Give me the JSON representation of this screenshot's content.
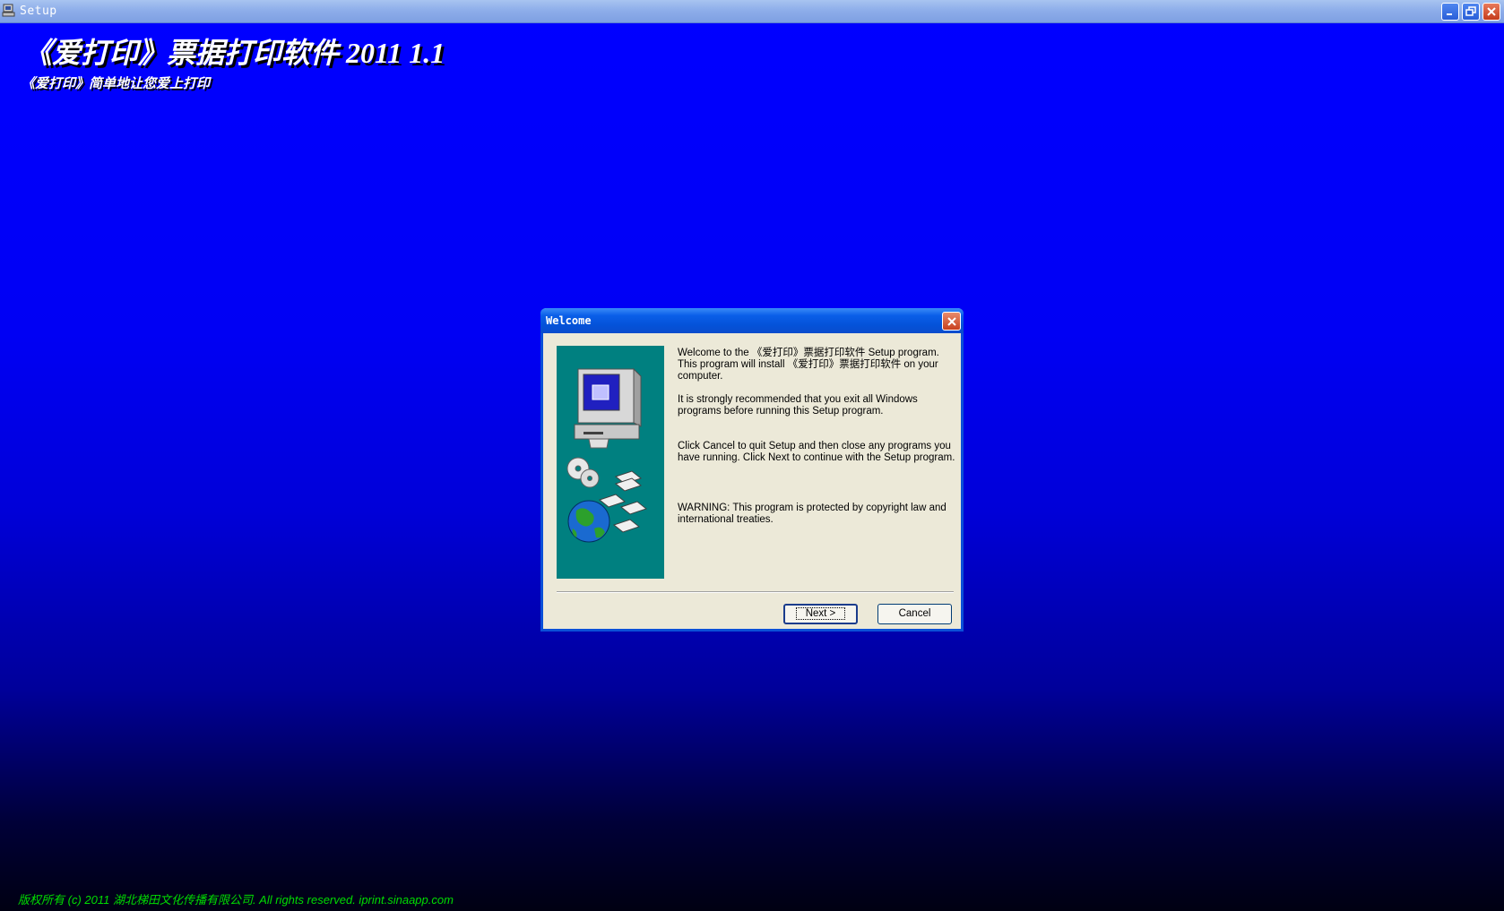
{
  "window": {
    "title": "Setup",
    "controls": [
      "minimize-icon",
      "restore-icon",
      "close-icon"
    ]
  },
  "banner": {
    "title": "《爱打印》票据打印软件 2011 1.1",
    "subtitle": "《爱打印》简单地让您爱上打印"
  },
  "dialog": {
    "title": "Welcome",
    "paragraphs": [
      "Welcome to the 《爱打印》票据打印软件 Setup program. This program will install 《爱打印》票据打印软件 on your computer.",
      "It is strongly recommended that you exit all Windows programs before running this Setup program.",
      "Click Cancel to quit Setup and then close any programs you have running. Click Next to continue with the Setup program.",
      "WARNING: This program is protected by copyright law and international treaties."
    ],
    "next_label": "Next >",
    "cancel_label": "Cancel"
  },
  "footer": {
    "copyright": "版权所有 (c) 2011 湖北梯田文化传播有限公司. All rights reserved. iprint.sinaapp.com"
  },
  "colors": {
    "desktop_top": "#0000ff",
    "desktop_bottom": "#000012",
    "copyright_text": "#00dd00",
    "side_panel": "#008080",
    "dialog_face": "#ece9d8"
  }
}
